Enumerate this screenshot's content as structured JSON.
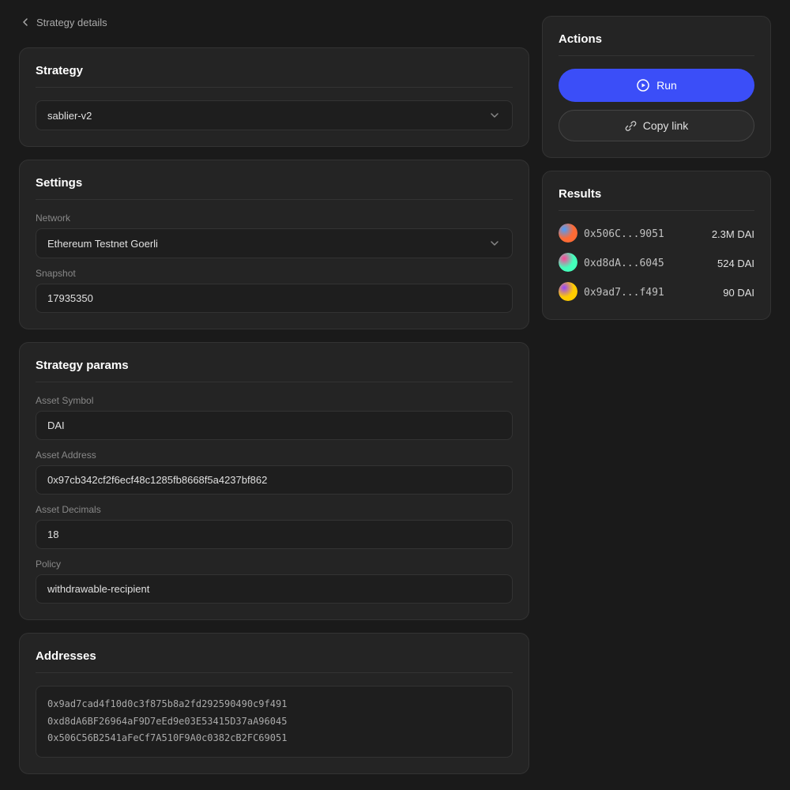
{
  "back": {
    "label": "Strategy details",
    "arrow": "←"
  },
  "strategy_card": {
    "title": "Strategy",
    "select_value": "sablier-v2"
  },
  "settings_card": {
    "title": "Settings",
    "network_label": "Network",
    "network_value": "Ethereum Testnet Goerli",
    "snapshot_label": "Snapshot",
    "snapshot_value": "17935350"
  },
  "params_card": {
    "title": "Strategy params",
    "asset_symbol_label": "Asset Symbol",
    "asset_symbol_value": "DAI",
    "asset_address_label": "Asset Address",
    "asset_address_value": "0x97cb342cf2f6ecf48c1285fb8668f5a4237bf862",
    "asset_decimals_label": "Asset Decimals",
    "asset_decimals_value": "18",
    "policy_label": "Policy",
    "policy_value": "withdrawable-recipient"
  },
  "addresses_card": {
    "title": "Addresses",
    "lines": [
      "0x9ad7cad4f10d0c3f875b8a2fd292590490c9f491",
      "0xd8dA6BF26964aF9D7eEd9e03E53415D37aA96045",
      "0x506C56B2541aFeCf7A510F9A0c0382cB2FC69051"
    ]
  },
  "actions_panel": {
    "title": "Actions",
    "run_label": "Run",
    "copy_link_label": "Copy link"
  },
  "results_panel": {
    "title": "Results",
    "items": [
      {
        "address": "0x506C...9051",
        "amount": "2.3M DAI",
        "avatar_color1": "#4a9eff",
        "avatar_color2": "#ff6b35"
      },
      {
        "address": "0xd8dA...6045",
        "amount": "524 DAI",
        "avatar_color1": "#ff4499",
        "avatar_color2": "#44ffbb"
      },
      {
        "address": "0x9ad7...f491",
        "amount": "90 DAI",
        "avatar_color1": "#9944ff",
        "avatar_color2": "#ffcc00"
      }
    ]
  }
}
